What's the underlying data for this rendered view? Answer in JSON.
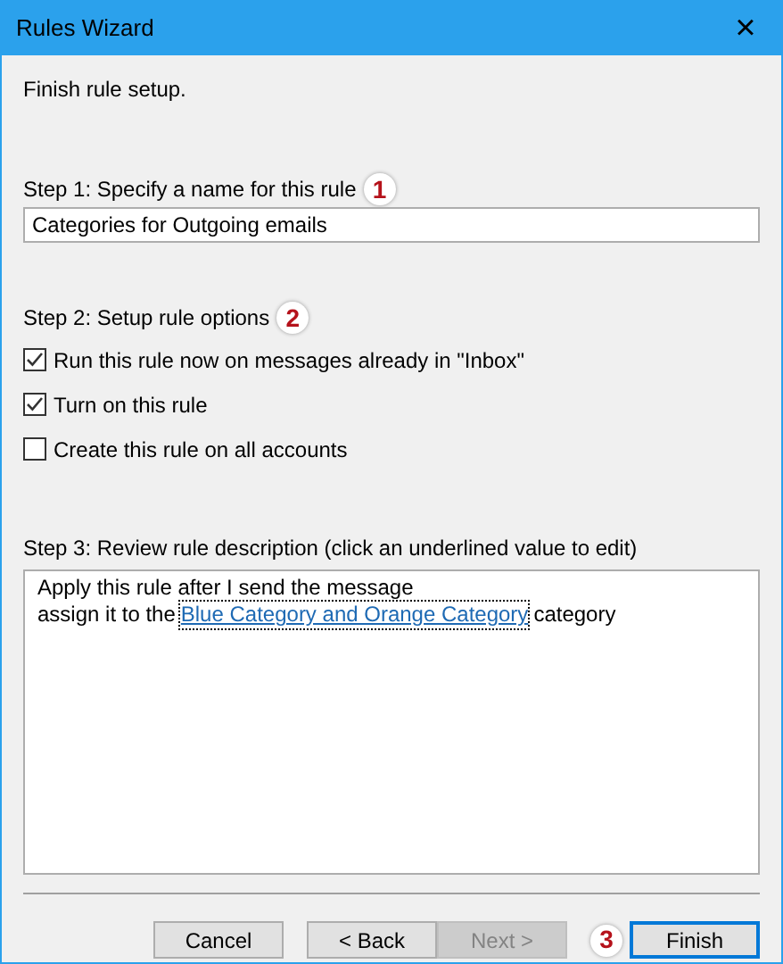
{
  "window": {
    "title": "Rules Wizard",
    "close": "×"
  },
  "intro": "Finish rule setup.",
  "step1": {
    "label": "Step 1: Specify a name for this rule",
    "badge": "1",
    "value": "Categories for Outgoing emails"
  },
  "step2": {
    "label": "Step 2: Setup rule options",
    "badge": "2",
    "options": [
      {
        "label": "Run this rule now on messages already in \"Inbox\"",
        "checked": true
      },
      {
        "label": "Turn on this rule",
        "checked": true
      },
      {
        "label": "Create this rule on all accounts",
        "checked": false
      }
    ]
  },
  "step3": {
    "label": "Step 3: Review rule description (click an underlined value to edit)",
    "lines": [
      [
        {
          "kind": "text",
          "text": "Apply this rule after I send the message"
        }
      ],
      [
        {
          "kind": "text",
          "text": "assign it to the"
        },
        {
          "kind": "link",
          "text": "Blue Category and Orange Category"
        },
        {
          "kind": "text",
          "text": "category"
        }
      ]
    ]
  },
  "buttons": [
    {
      "label": "Cancel",
      "disabled": false,
      "default": false
    },
    {
      "label": "< Back",
      "disabled": false,
      "default": false
    },
    {
      "label": "Next >",
      "disabled": true,
      "default": false
    },
    {
      "label": "Finish",
      "disabled": false,
      "default": true,
      "badge": "3"
    }
  ]
}
